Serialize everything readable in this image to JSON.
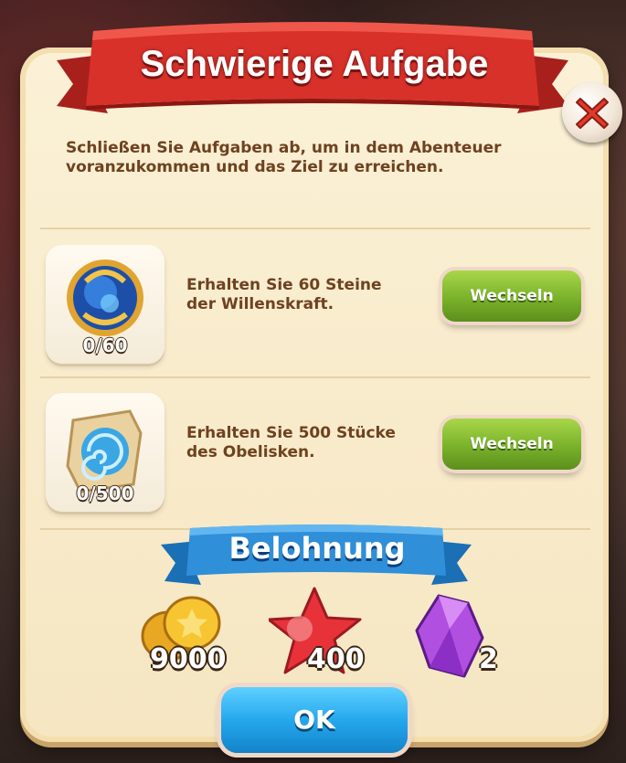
{
  "dialog": {
    "title": "Schwierige Aufgabe",
    "description": "Schließen Sie Aufgaben ab, um in dem Abenteuer voranzukommen und das Ziel zu erreichen."
  },
  "tasks": [
    {
      "icon": "willpower-stone-icon",
      "counter": "0/60",
      "text": "Erhalten Sie 60 Steine der Willenskraft.",
      "button_label": "Wechseln"
    },
    {
      "icon": "obelisk-piece-icon",
      "counter": "0/500",
      "text": "Erhalten Sie 500 Stücke des Obelisken.",
      "button_label": "Wechseln"
    }
  ],
  "reward": {
    "title": "Belohnung",
    "items": [
      {
        "icon": "gold-coins-icon",
        "value": "9000"
      },
      {
        "icon": "red-star-icon",
        "value": "400"
      },
      {
        "icon": "purple-gem-icon",
        "value": "2"
      }
    ]
  },
  "ok_label": "OK",
  "colors": {
    "title_ribbon": "#d8312a",
    "reward_ribbon": "#2f8fd8",
    "panel": "#fbf1d6",
    "text": "#6e4220",
    "green_button": "#79b22a",
    "ok_button": "#25a8ee"
  }
}
